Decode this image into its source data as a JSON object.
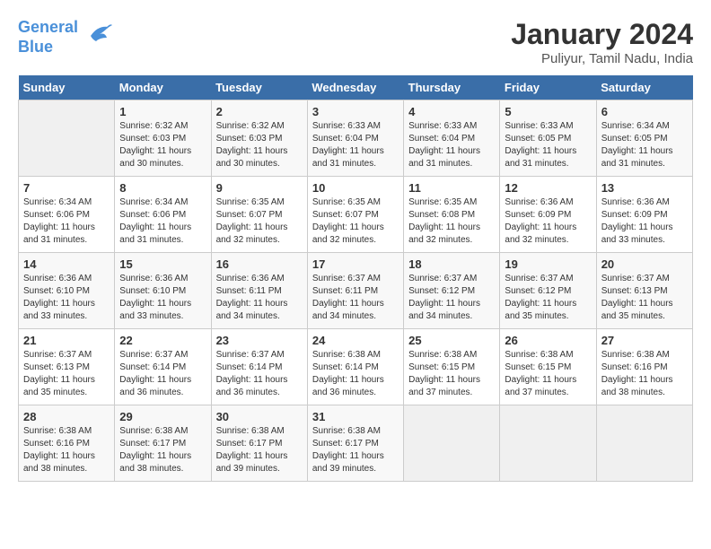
{
  "logo": {
    "line1": "General",
    "line2": "Blue"
  },
  "title": "January 2024",
  "subtitle": "Puliyur, Tamil Nadu, India",
  "headers": [
    "Sunday",
    "Monday",
    "Tuesday",
    "Wednesday",
    "Thursday",
    "Friday",
    "Saturday"
  ],
  "weeks": [
    [
      {
        "day": "",
        "info": ""
      },
      {
        "day": "1",
        "info": "Sunrise: 6:32 AM\nSunset: 6:03 PM\nDaylight: 11 hours\nand 30 minutes."
      },
      {
        "day": "2",
        "info": "Sunrise: 6:32 AM\nSunset: 6:03 PM\nDaylight: 11 hours\nand 30 minutes."
      },
      {
        "day": "3",
        "info": "Sunrise: 6:33 AM\nSunset: 6:04 PM\nDaylight: 11 hours\nand 31 minutes."
      },
      {
        "day": "4",
        "info": "Sunrise: 6:33 AM\nSunset: 6:04 PM\nDaylight: 11 hours\nand 31 minutes."
      },
      {
        "day": "5",
        "info": "Sunrise: 6:33 AM\nSunset: 6:05 PM\nDaylight: 11 hours\nand 31 minutes."
      },
      {
        "day": "6",
        "info": "Sunrise: 6:34 AM\nSunset: 6:05 PM\nDaylight: 11 hours\nand 31 minutes."
      }
    ],
    [
      {
        "day": "7",
        "info": "Sunrise: 6:34 AM\nSunset: 6:06 PM\nDaylight: 11 hours\nand 31 minutes."
      },
      {
        "day": "8",
        "info": "Sunrise: 6:34 AM\nSunset: 6:06 PM\nDaylight: 11 hours\nand 31 minutes."
      },
      {
        "day": "9",
        "info": "Sunrise: 6:35 AM\nSunset: 6:07 PM\nDaylight: 11 hours\nand 32 minutes."
      },
      {
        "day": "10",
        "info": "Sunrise: 6:35 AM\nSunset: 6:07 PM\nDaylight: 11 hours\nand 32 minutes."
      },
      {
        "day": "11",
        "info": "Sunrise: 6:35 AM\nSunset: 6:08 PM\nDaylight: 11 hours\nand 32 minutes."
      },
      {
        "day": "12",
        "info": "Sunrise: 6:36 AM\nSunset: 6:09 PM\nDaylight: 11 hours\nand 32 minutes."
      },
      {
        "day": "13",
        "info": "Sunrise: 6:36 AM\nSunset: 6:09 PM\nDaylight: 11 hours\nand 33 minutes."
      }
    ],
    [
      {
        "day": "14",
        "info": "Sunrise: 6:36 AM\nSunset: 6:10 PM\nDaylight: 11 hours\nand 33 minutes."
      },
      {
        "day": "15",
        "info": "Sunrise: 6:36 AM\nSunset: 6:10 PM\nDaylight: 11 hours\nand 33 minutes."
      },
      {
        "day": "16",
        "info": "Sunrise: 6:36 AM\nSunset: 6:11 PM\nDaylight: 11 hours\nand 34 minutes."
      },
      {
        "day": "17",
        "info": "Sunrise: 6:37 AM\nSunset: 6:11 PM\nDaylight: 11 hours\nand 34 minutes."
      },
      {
        "day": "18",
        "info": "Sunrise: 6:37 AM\nSunset: 6:12 PM\nDaylight: 11 hours\nand 34 minutes."
      },
      {
        "day": "19",
        "info": "Sunrise: 6:37 AM\nSunset: 6:12 PM\nDaylight: 11 hours\nand 35 minutes."
      },
      {
        "day": "20",
        "info": "Sunrise: 6:37 AM\nSunset: 6:13 PM\nDaylight: 11 hours\nand 35 minutes."
      }
    ],
    [
      {
        "day": "21",
        "info": "Sunrise: 6:37 AM\nSunset: 6:13 PM\nDaylight: 11 hours\nand 35 minutes."
      },
      {
        "day": "22",
        "info": "Sunrise: 6:37 AM\nSunset: 6:14 PM\nDaylight: 11 hours\nand 36 minutes."
      },
      {
        "day": "23",
        "info": "Sunrise: 6:37 AM\nSunset: 6:14 PM\nDaylight: 11 hours\nand 36 minutes."
      },
      {
        "day": "24",
        "info": "Sunrise: 6:38 AM\nSunset: 6:14 PM\nDaylight: 11 hours\nand 36 minutes."
      },
      {
        "day": "25",
        "info": "Sunrise: 6:38 AM\nSunset: 6:15 PM\nDaylight: 11 hours\nand 37 minutes."
      },
      {
        "day": "26",
        "info": "Sunrise: 6:38 AM\nSunset: 6:15 PM\nDaylight: 11 hours\nand 37 minutes."
      },
      {
        "day": "27",
        "info": "Sunrise: 6:38 AM\nSunset: 6:16 PM\nDaylight: 11 hours\nand 38 minutes."
      }
    ],
    [
      {
        "day": "28",
        "info": "Sunrise: 6:38 AM\nSunset: 6:16 PM\nDaylight: 11 hours\nand 38 minutes."
      },
      {
        "day": "29",
        "info": "Sunrise: 6:38 AM\nSunset: 6:17 PM\nDaylight: 11 hours\nand 38 minutes."
      },
      {
        "day": "30",
        "info": "Sunrise: 6:38 AM\nSunset: 6:17 PM\nDaylight: 11 hours\nand 39 minutes."
      },
      {
        "day": "31",
        "info": "Sunrise: 6:38 AM\nSunset: 6:17 PM\nDaylight: 11 hours\nand 39 minutes."
      },
      {
        "day": "",
        "info": ""
      },
      {
        "day": "",
        "info": ""
      },
      {
        "day": "",
        "info": ""
      }
    ]
  ]
}
